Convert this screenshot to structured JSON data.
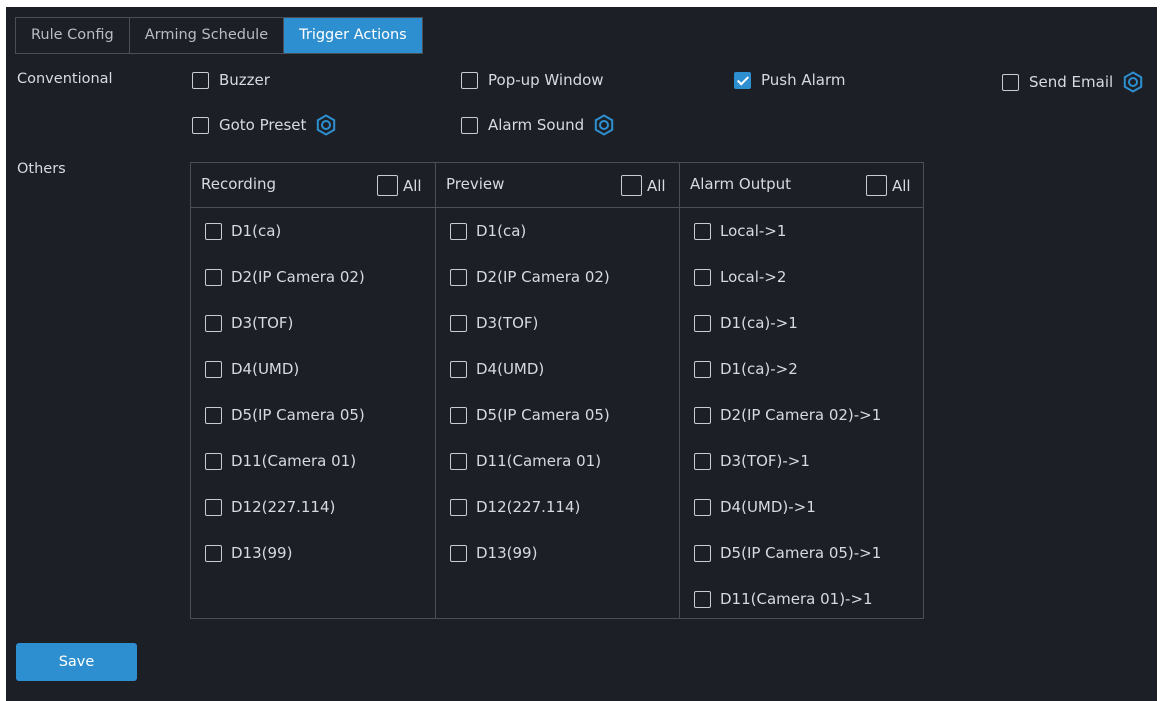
{
  "tabs": [
    {
      "label": "Rule Config",
      "active": false
    },
    {
      "label": "Arming Schedule",
      "active": false
    },
    {
      "label": "Trigger Actions",
      "active": true
    }
  ],
  "conventional": {
    "label": "Conventional",
    "options": [
      {
        "label": "Buzzer",
        "checked": false,
        "has_settings": false
      },
      {
        "label": "Pop-up Window",
        "checked": false,
        "has_settings": false
      },
      {
        "label": "Push Alarm",
        "checked": true,
        "has_settings": false
      },
      {
        "label": "Send Email",
        "checked": false,
        "has_settings": true
      },
      {
        "label": "Goto Preset",
        "checked": false,
        "has_settings": true
      },
      {
        "label": "Alarm Sound",
        "checked": false,
        "has_settings": true
      }
    ]
  },
  "others": {
    "label": "Others",
    "all_label": "All",
    "columns": [
      {
        "title": "Recording",
        "all_checked": false,
        "items": [
          "D1(ca)",
          "D2(IP Camera 02)",
          "D3(TOF)",
          "D4(UMD)",
          "D5(IP Camera 05)",
          "D11(Camera 01)",
          "D12(227.114)",
          "D13(99)"
        ]
      },
      {
        "title": "Preview",
        "all_checked": false,
        "items": [
          "D1(ca)",
          "D2(IP Camera 02)",
          "D3(TOF)",
          "D4(UMD)",
          "D5(IP Camera 05)",
          "D11(Camera 01)",
          "D12(227.114)",
          "D13(99)"
        ]
      },
      {
        "title": "Alarm Output",
        "all_checked": false,
        "items": [
          "Local->1",
          "Local->2",
          "D1(ca)->1",
          "D1(ca)->2",
          "D2(IP Camera 02)->1",
          "D3(TOF)->1",
          "D4(UMD)->1",
          "D5(IP Camera 05)->1",
          "D11(Camera 01)->1"
        ]
      }
    ]
  },
  "save_label": "Save",
  "colors": {
    "accent": "#2e8fd0",
    "background": "#1c1f26",
    "border": "#4a4e57"
  }
}
